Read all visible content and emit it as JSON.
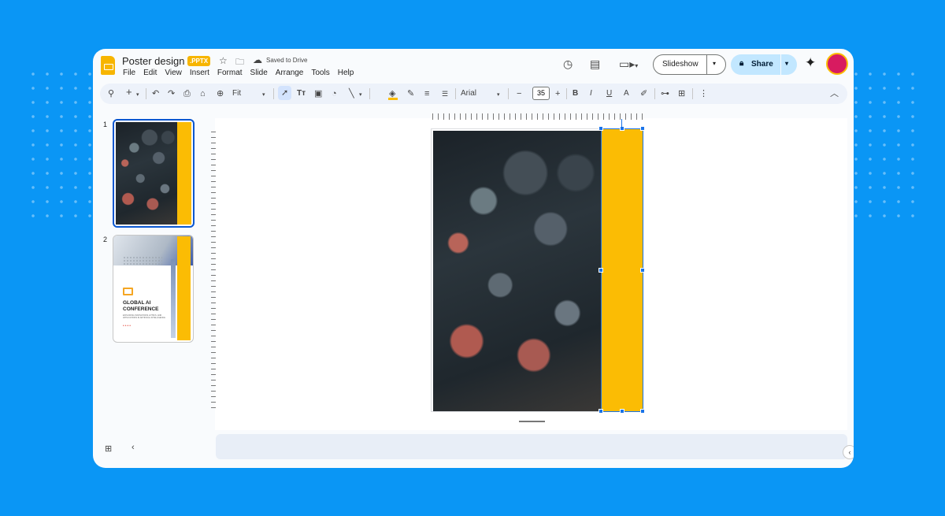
{
  "document": {
    "title": "Poster design",
    "format_badge": ".PPTX",
    "save_status": "Saved to Drive"
  },
  "menu": [
    "File",
    "Edit",
    "View",
    "Insert",
    "Format",
    "Slide",
    "Arrange",
    "Tools",
    "Help"
  ],
  "header": {
    "slideshow_label": "Slideshow",
    "share_label": "Share",
    "avatar_color": "#d81b60"
  },
  "toolbar": {
    "zoom": "Fit",
    "font": "Arial",
    "font_size": "35"
  },
  "slides": [
    {
      "number": "1"
    },
    {
      "number": "2",
      "heading_line1": "GLOBAL AI",
      "heading_line2": "CONFERENCE",
      "subtext": "EXPLORING INNOVATIONS, ETHICS, AND APPLICATIONS IN ARTIFICIAL INTELLIGENCE"
    }
  ],
  "colors": {
    "accent_yellow": "#fbbc04",
    "selection_blue": "#1a73e8",
    "page_background": "#0a96f5"
  },
  "icons": [
    "search-icon",
    "add-icon",
    "undo-icon",
    "redo-icon",
    "print-icon",
    "paint-format-icon",
    "zoom-icon",
    "select-icon",
    "text-box-icon",
    "image-icon",
    "shape-icon",
    "line-icon",
    "fill-color-icon",
    "border-color-icon",
    "border-weight-icon",
    "border-dash-icon",
    "bold-icon",
    "italic-icon",
    "underline-icon",
    "text-color-icon",
    "highlight-icon",
    "link-icon",
    "comment-icon",
    "more-icon",
    "history-icon",
    "comments-icon",
    "meet-icon",
    "lock-icon",
    "gemini-icon",
    "grid-view-icon",
    "collapse-icon"
  ]
}
